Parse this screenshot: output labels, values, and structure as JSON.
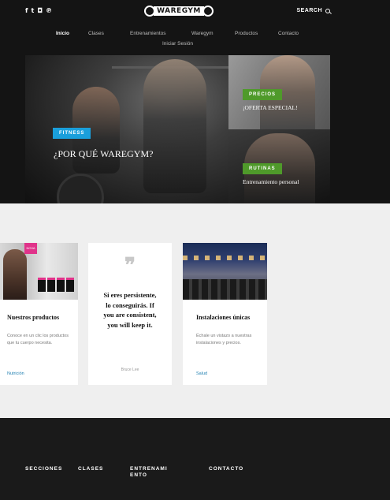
{
  "header": {
    "social": [
      "f",
      "t",
      "◘",
      "℗"
    ],
    "logo": "WAREGYM",
    "search_label": "SEARCH"
  },
  "nav": {
    "items": [
      "Inicio",
      "Clases",
      "Entrenamientos",
      "Waregym",
      "Productos",
      "Contacto",
      "Iniciar Sesión"
    ]
  },
  "hero": {
    "main": {
      "tag": "FITNESS",
      "title": "¿POR QUÉ WAREGYM?"
    },
    "right_top": {
      "tag": "PRECIOS",
      "title": "¡OFERTA ESPECIAL!"
    },
    "right_bottom": {
      "tag": "RUTINAS",
      "title": "Entrenamiento personal"
    }
  },
  "cards": [
    {
      "title": "Nuestros productos",
      "text": "Conoce en un clic los productos que tu cuerpo necesita.",
      "link": "Nutrición",
      "badge": "NOVA"
    },
    {
      "quote_mark": "❞",
      "quote": "Si eres persistente, lo conseguirás. If you are consistent, you will keep it.",
      "author": "Bruce Lee"
    },
    {
      "title": "Instalaciones únicas",
      "text": "Échale un vistazo a nuestras instalaciones y precios.",
      "link": "Salud"
    }
  ],
  "footer": {
    "columns": [
      "SECCIONES",
      "CLASES",
      "ENTRENAMI ENTO",
      "CONTACTO"
    ]
  },
  "colors": {
    "header_bg": "#141414",
    "tag_blue": "#1a9fdb",
    "tag_green": "#4f9a2a",
    "link": "#1f7fb1",
    "footer_bg": "#1a1a1a"
  }
}
